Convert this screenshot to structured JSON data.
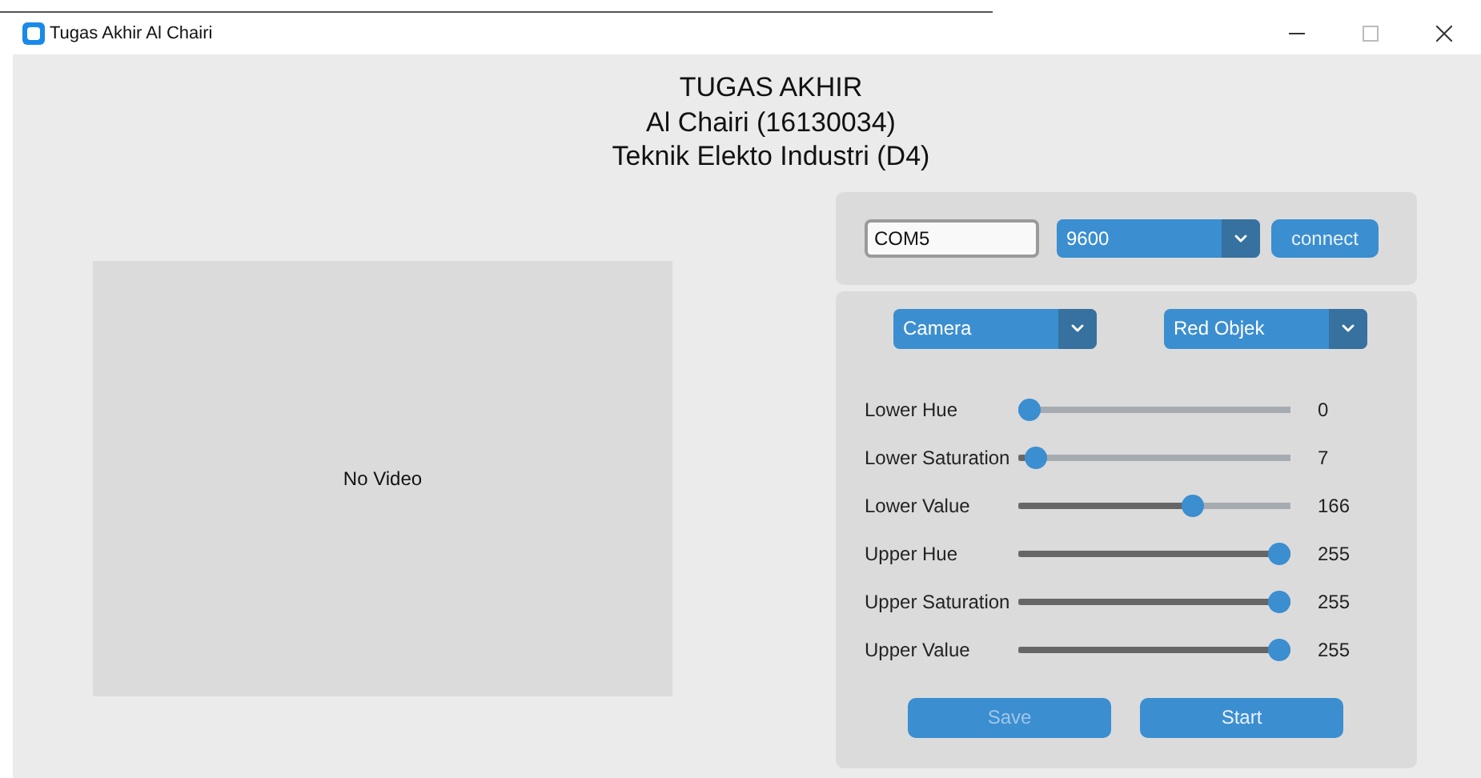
{
  "window": {
    "title": "Tugas Akhir Al Chairi"
  },
  "header": {
    "lines": [
      "TUGAS AKHIR",
      "Al Chairi (16130034)",
      "Teknik Elekto Industri (D4)"
    ]
  },
  "video": {
    "message": "No Video"
  },
  "connection": {
    "port": "COM5",
    "baud": "9600",
    "connect_label": "connect"
  },
  "selectors": [
    {
      "value": "Camera"
    },
    {
      "value": "Red Objek"
    }
  ],
  "sliders": [
    {
      "label": "Lower Hue",
      "level": 0,
      "reading": "0"
    },
    {
      "label": "Lower Saturation",
      "level": 0.027,
      "reading": "7"
    },
    {
      "label": "Lower Value",
      "level": 0.651,
      "reading": "166"
    },
    {
      "label": "Upper Hue",
      "level": 1,
      "reading": "255"
    },
    {
      "label": "Upper Saturation",
      "level": 1,
      "reading": "255"
    },
    {
      "label": "Upper Value",
      "level": 1,
      "reading": "255"
    }
  ],
  "buttons": [
    {
      "label": "Save",
      "disabled": true
    },
    {
      "label": "Start",
      "disabled": false
    }
  ]
}
